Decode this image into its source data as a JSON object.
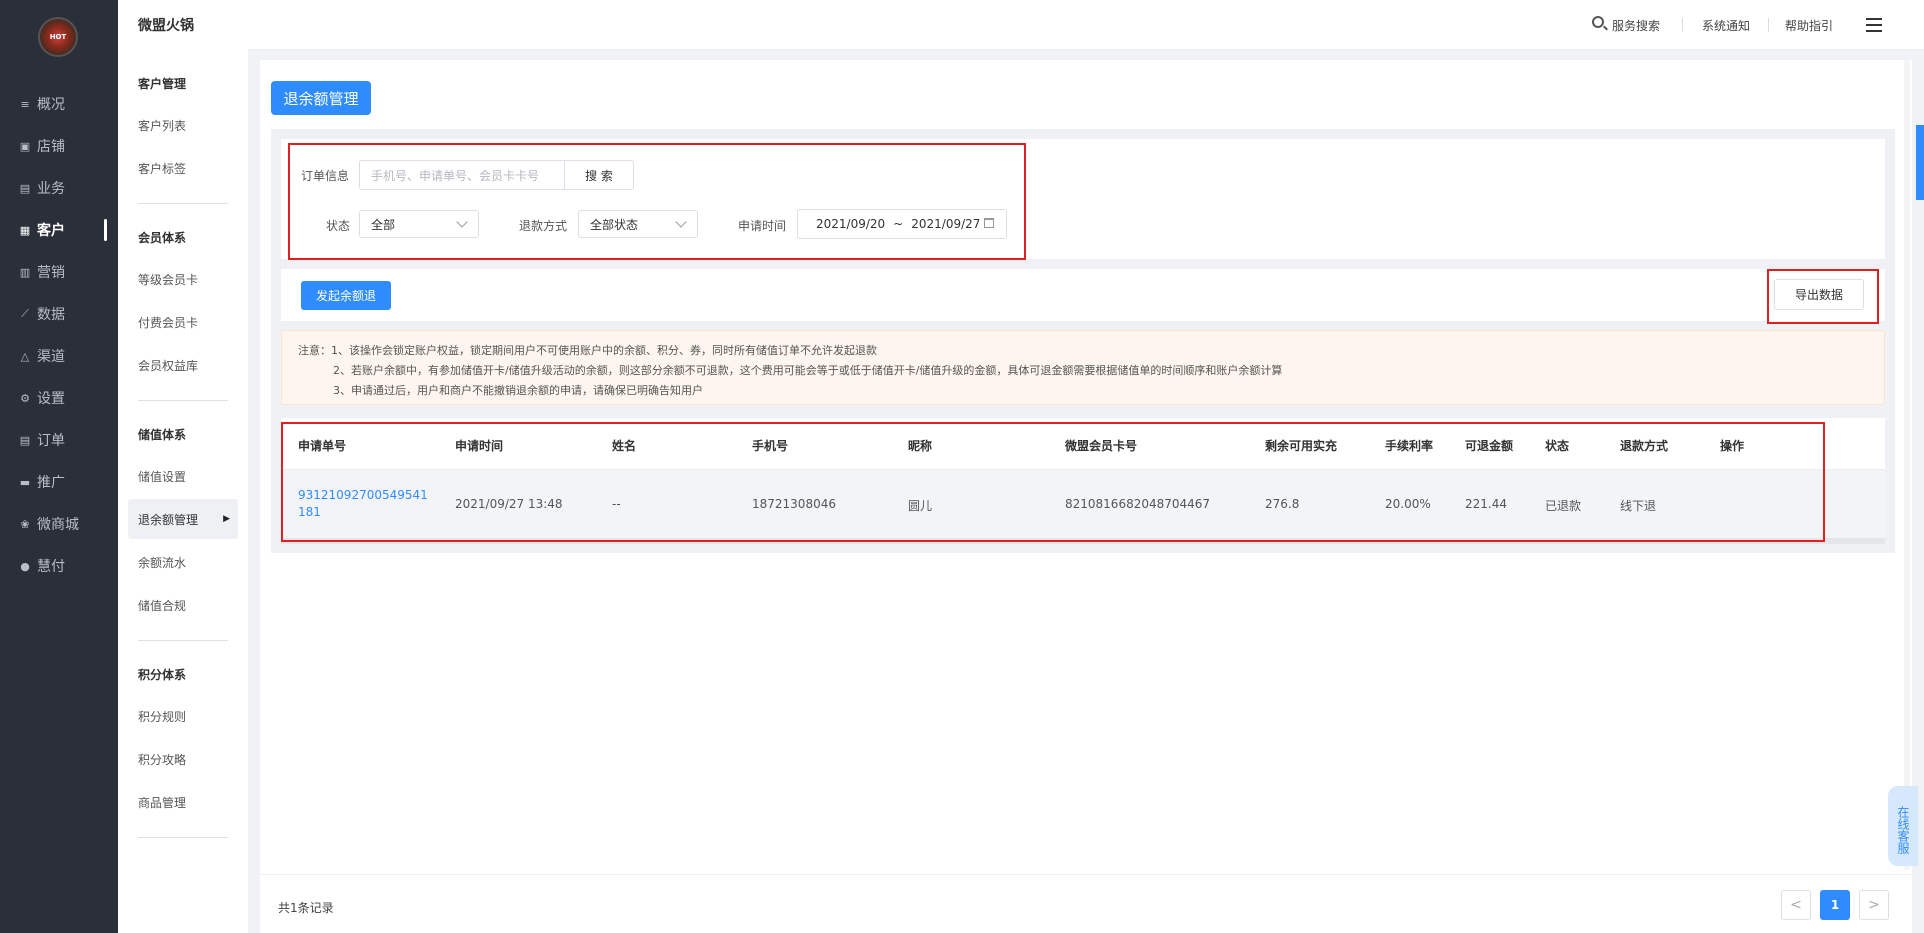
{
  "nav": {
    "logo_text": "HOT",
    "items": [
      {
        "label": "概况",
        "icon": "list-icon"
      },
      {
        "label": "店铺",
        "icon": "store-icon"
      },
      {
        "label": "业务",
        "icon": "briefcase-icon"
      },
      {
        "label": "客户",
        "icon": "customer-icon"
      },
      {
        "label": "营销",
        "icon": "bar-chart-icon"
      },
      {
        "label": "数据",
        "icon": "line-chart-icon"
      },
      {
        "label": "渠道",
        "icon": "channel-icon"
      },
      {
        "label": "设置",
        "icon": "gear-icon"
      },
      {
        "label": "订单",
        "icon": "order-icon"
      },
      {
        "label": "推广",
        "icon": "promo-icon"
      },
      {
        "label": "微商城",
        "icon": "mall-icon"
      },
      {
        "label": "慧付",
        "icon": "pay-icon"
      }
    ]
  },
  "header": {
    "brand": "微盟火锅",
    "service_search": "服务搜索",
    "notifications": "系统通知",
    "help": "帮助指引"
  },
  "subnav": {
    "groups": [
      {
        "title": "客户管理",
        "items": [
          "客户列表",
          "客户标签"
        ]
      },
      {
        "title": "会员体系",
        "items": [
          "等级会员卡",
          "付费会员卡",
          "会员权益库"
        ]
      },
      {
        "title": "储值体系",
        "items": [
          "储值设置",
          "退余额管理",
          "余额流水",
          "储值合规"
        ]
      },
      {
        "title": "积分体系",
        "items": [
          "积分规则",
          "积分攻略",
          "商品管理"
        ]
      }
    ]
  },
  "page": {
    "title": "退余额管理",
    "filters": {
      "order_info_label": "订单信息",
      "order_info_placeholder": "手机号、申请单号、会员卡卡号",
      "search_button": "搜 索",
      "status_label": "状态",
      "status_value": "全部",
      "refund_method_label": "退款方式",
      "refund_method_value": "全部状态",
      "apply_time_label": "申请时间",
      "date_from": "2021/09/20",
      "date_sep": "~",
      "date_to": "2021/09/27"
    },
    "actions": {
      "initiate_refund": "发起余额退",
      "export": "导出数据"
    },
    "notice": [
      "注意：1、该操作会锁定账户权益，锁定期间用户不可使用账户中的余额、积分、券，同时所有储值订单不允许发起退款",
      "2、若账户余额中，有参加储值开卡/储值升级活动的余额，则这部分余额不可退款，这个费用可能会等于或低于储值开卡/储值升级的金额，具体可退金额需要根据储值单的时间顺序和账户余额计算",
      "3、申请通过后，用户和商户不能撤销退余额的申请，请确保已明确告知用户"
    ],
    "table": {
      "columns": [
        "申请单号",
        "申请时间",
        "姓名",
        "手机号",
        "昵称",
        "微盟会员卡号",
        "剩余可用实充",
        "手续利率",
        "可退金额",
        "状态",
        "退款方式",
        "操作"
      ],
      "rows": [
        {
          "apply_no": "93121092700549541181",
          "apply_no_line1": "93121092700549541",
          "apply_no_line2": "181",
          "apply_time": "2021/09/27 13:48",
          "name": "--",
          "phone": "18721308046",
          "nickname": "圆儿",
          "card_no": "8210816682048704467",
          "remaining": "276.8",
          "fee_rate": "20.00%",
          "refundable": "221.44",
          "status": "已退款",
          "method": "线下退",
          "operation": ""
        }
      ]
    },
    "pagination": {
      "total": "共1条记录",
      "prev": "<",
      "current": "1",
      "next": ">"
    },
    "online_service": "在线客服"
  },
  "colors": {
    "primary": "#2f8cff",
    "nav_bg": "#2a2f3a",
    "highlight_box": "#e02020"
  }
}
